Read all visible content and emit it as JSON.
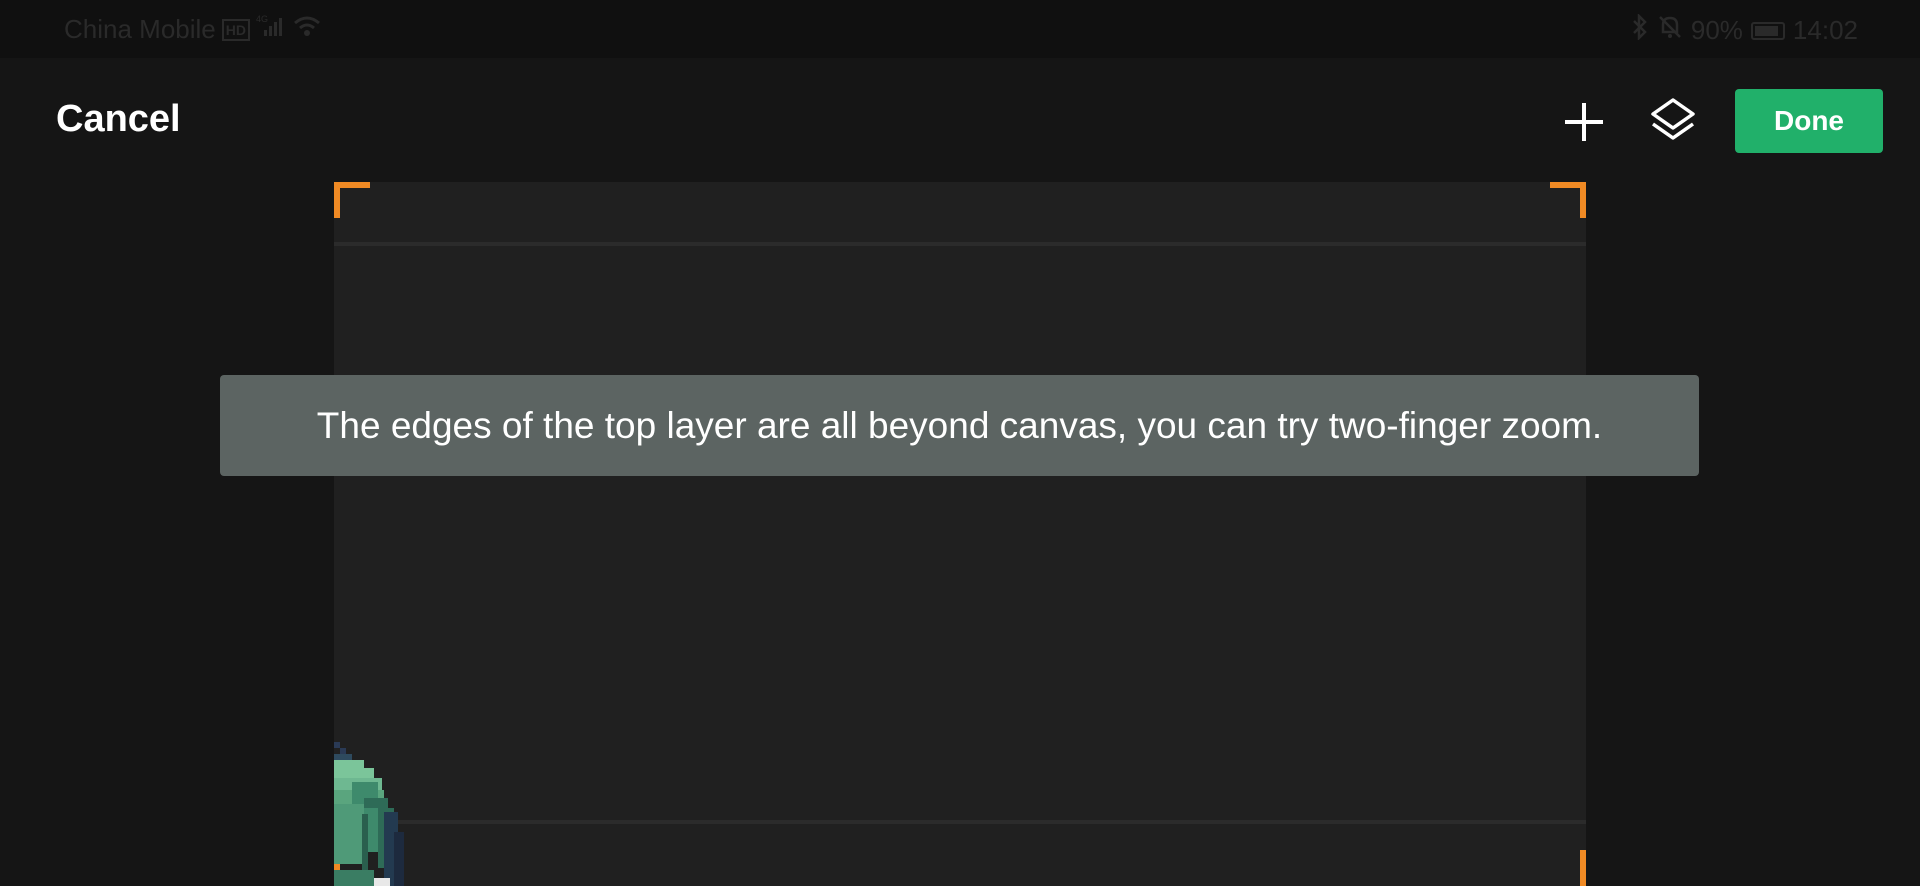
{
  "status_bar": {
    "carrier": "China Mobile",
    "network_badge": "HD",
    "network_type": "4G",
    "battery_percent": "90%",
    "time": "14:02",
    "battery_level": 0.9
  },
  "toolbar": {
    "cancel_label": "Cancel",
    "add_icon": "plus-icon",
    "layers_icon": "layers-icon",
    "done_label": "Done"
  },
  "toast": {
    "message": "The edges of the top layer are all beyond canvas, you can try two-finger zoom."
  },
  "colors": {
    "accent_green": "#21b06a",
    "crop_corner_orange": "#f08a24",
    "toast_bg": "#5c6462",
    "canvas_bg": "#202020",
    "app_bg": "#151515"
  }
}
